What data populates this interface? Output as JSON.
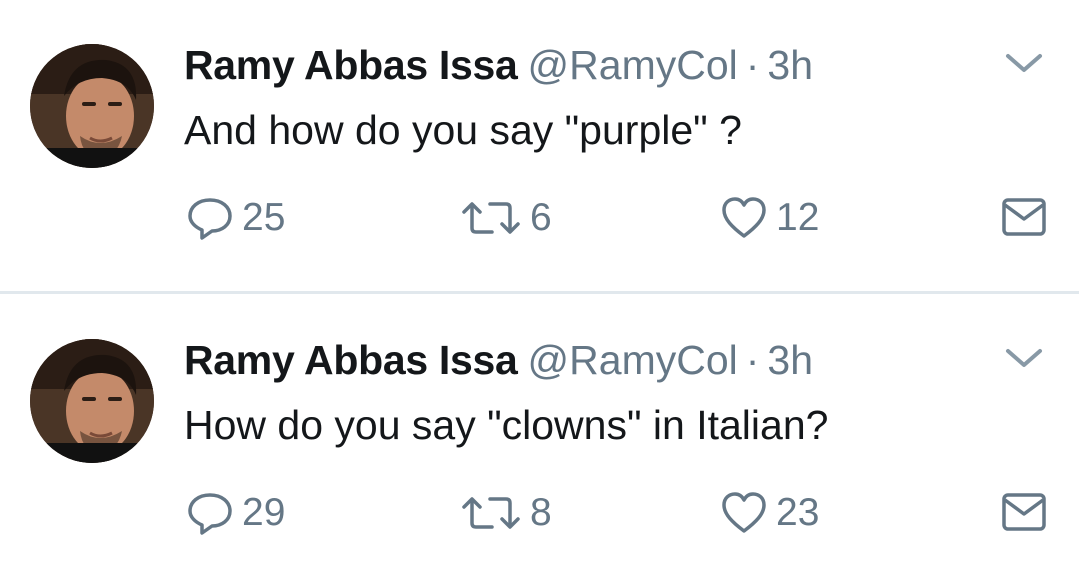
{
  "tweets": [
    {
      "author_name": "Ramy Abbas Issa",
      "handle": "@RamyCol",
      "separator": "·",
      "time": "3h",
      "text": "And how do you say \"purple\" ?",
      "replies": "25",
      "retweets": "6",
      "likes": "12"
    },
    {
      "author_name": "Ramy Abbas Issa",
      "handle": "@RamyCol",
      "separator": "·",
      "time": "3h",
      "text": "How do you say \"clowns\" in Italian?",
      "replies": "29",
      "retweets": "8",
      "likes": "23"
    }
  ],
  "colors": {
    "text_primary": "#14171a",
    "text_secondary": "#657786",
    "divider": "#e1e8ed"
  },
  "icons": [
    "caret-down-icon",
    "reply-icon",
    "retweet-icon",
    "like-icon",
    "direct-message-icon"
  ]
}
